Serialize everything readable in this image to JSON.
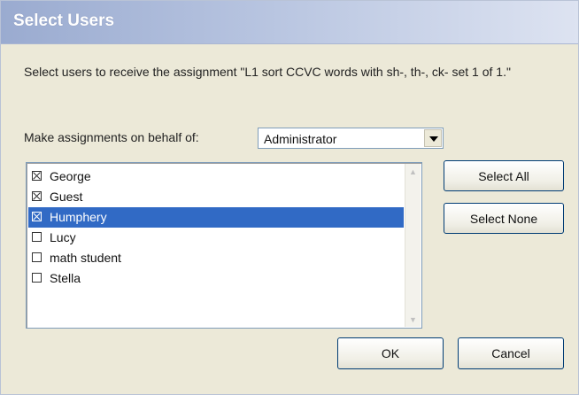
{
  "window": {
    "title": "Select Users"
  },
  "prompt": {
    "text": "Select users to receive the assignment \"L1 sort CCVC words with sh-, th-, ck- set 1 of 1.\""
  },
  "behalf": {
    "label": "Make assignments on behalf of:",
    "selected": "Administrator"
  },
  "users": [
    {
      "label": "George",
      "checked": true,
      "selected": false
    },
    {
      "label": "Guest",
      "checked": true,
      "selected": false
    },
    {
      "label": "Humphery",
      "checked": true,
      "selected": true
    },
    {
      "label": "Lucy",
      "checked": false,
      "selected": false
    },
    {
      "label": "math student",
      "checked": false,
      "selected": false
    },
    {
      "label": "Stella",
      "checked": false,
      "selected": false
    }
  ],
  "buttons": {
    "select_all": "Select All",
    "select_none": "Select None",
    "ok": "OK",
    "cancel": "Cancel"
  },
  "colors": {
    "selection": "#316ac5",
    "dialog_background": "#ece9d8"
  }
}
